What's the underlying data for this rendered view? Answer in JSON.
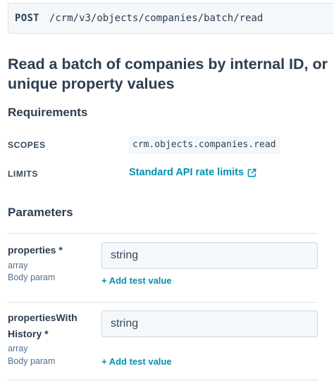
{
  "endpoint": {
    "method": "POST",
    "path": "/crm/v3/objects/companies/batch/read"
  },
  "title": "Read a batch of companies by internal ID, or unique property values",
  "requirements": {
    "heading": "Requirements",
    "scopes_label": "SCOPES",
    "scope_value": "crm.objects.companies.read",
    "limits_label": "LIMITS",
    "limits_link": "Standard API rate limits",
    "limits_icon": "external-link-icon"
  },
  "parameters": {
    "heading": "Parameters",
    "items": [
      {
        "name": "properties *",
        "type": "array",
        "location": "Body param",
        "input_value": "string",
        "add_test": "+ Add test value"
      },
      {
        "name": "propertiesWith History *",
        "type": "array",
        "location": "Body param",
        "input_value": "string",
        "add_test": "+ Add test value"
      }
    ]
  },
  "colors": {
    "link": "#0091ae",
    "heading": "#2d3e50",
    "muted": "#516f90",
    "code_bg": "#f5f8fa"
  }
}
